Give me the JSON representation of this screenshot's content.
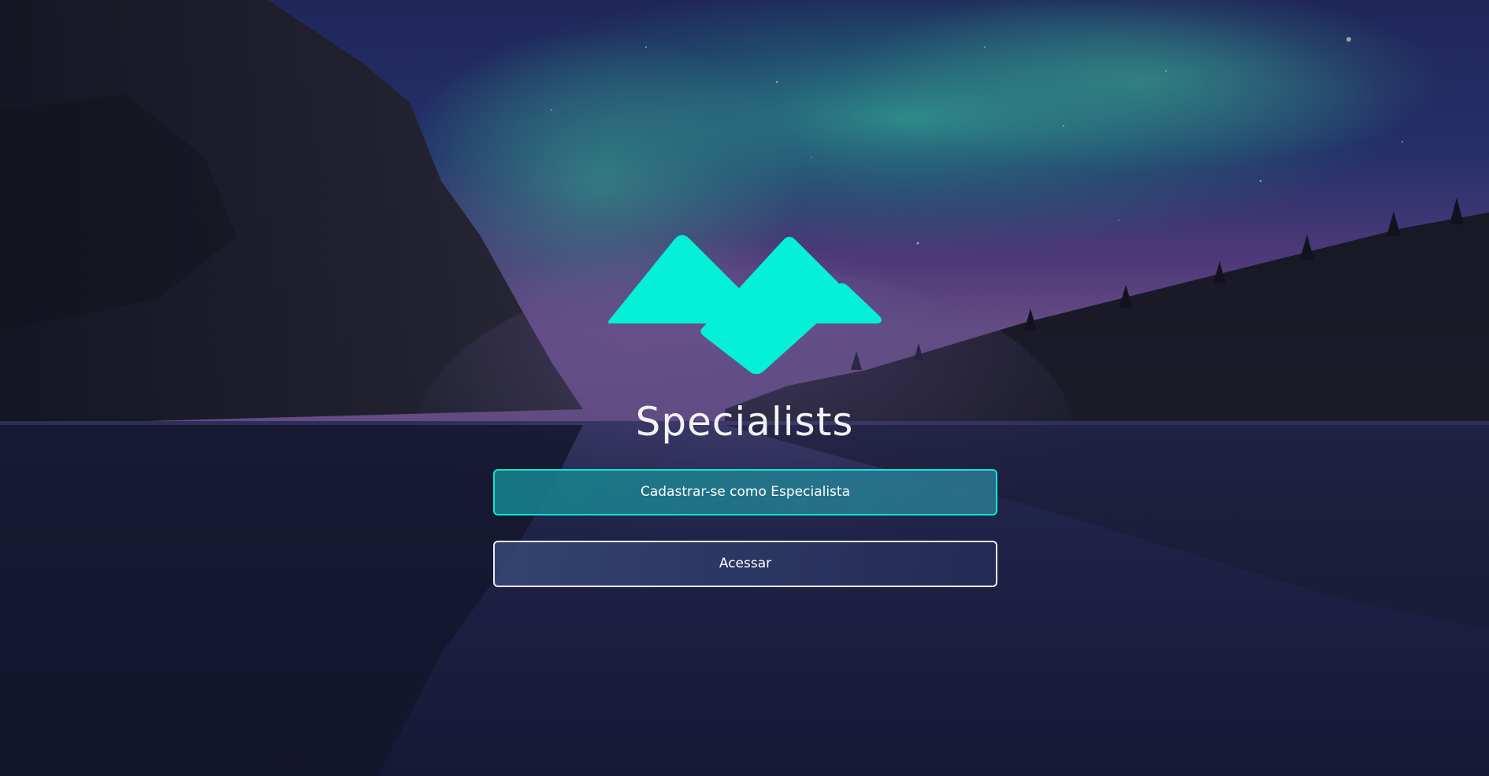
{
  "brand": {
    "title": "Specialists",
    "logo_icon": "specialists-mountain-logo-icon",
    "logo_color": "#05f0d8"
  },
  "actions": {
    "register_label": "Cadastrar-se como Especialista",
    "login_label": "Acessar"
  },
  "colors": {
    "accent": "#10e6d2",
    "login_border": "#e9ecf5",
    "background": "#14152e"
  }
}
